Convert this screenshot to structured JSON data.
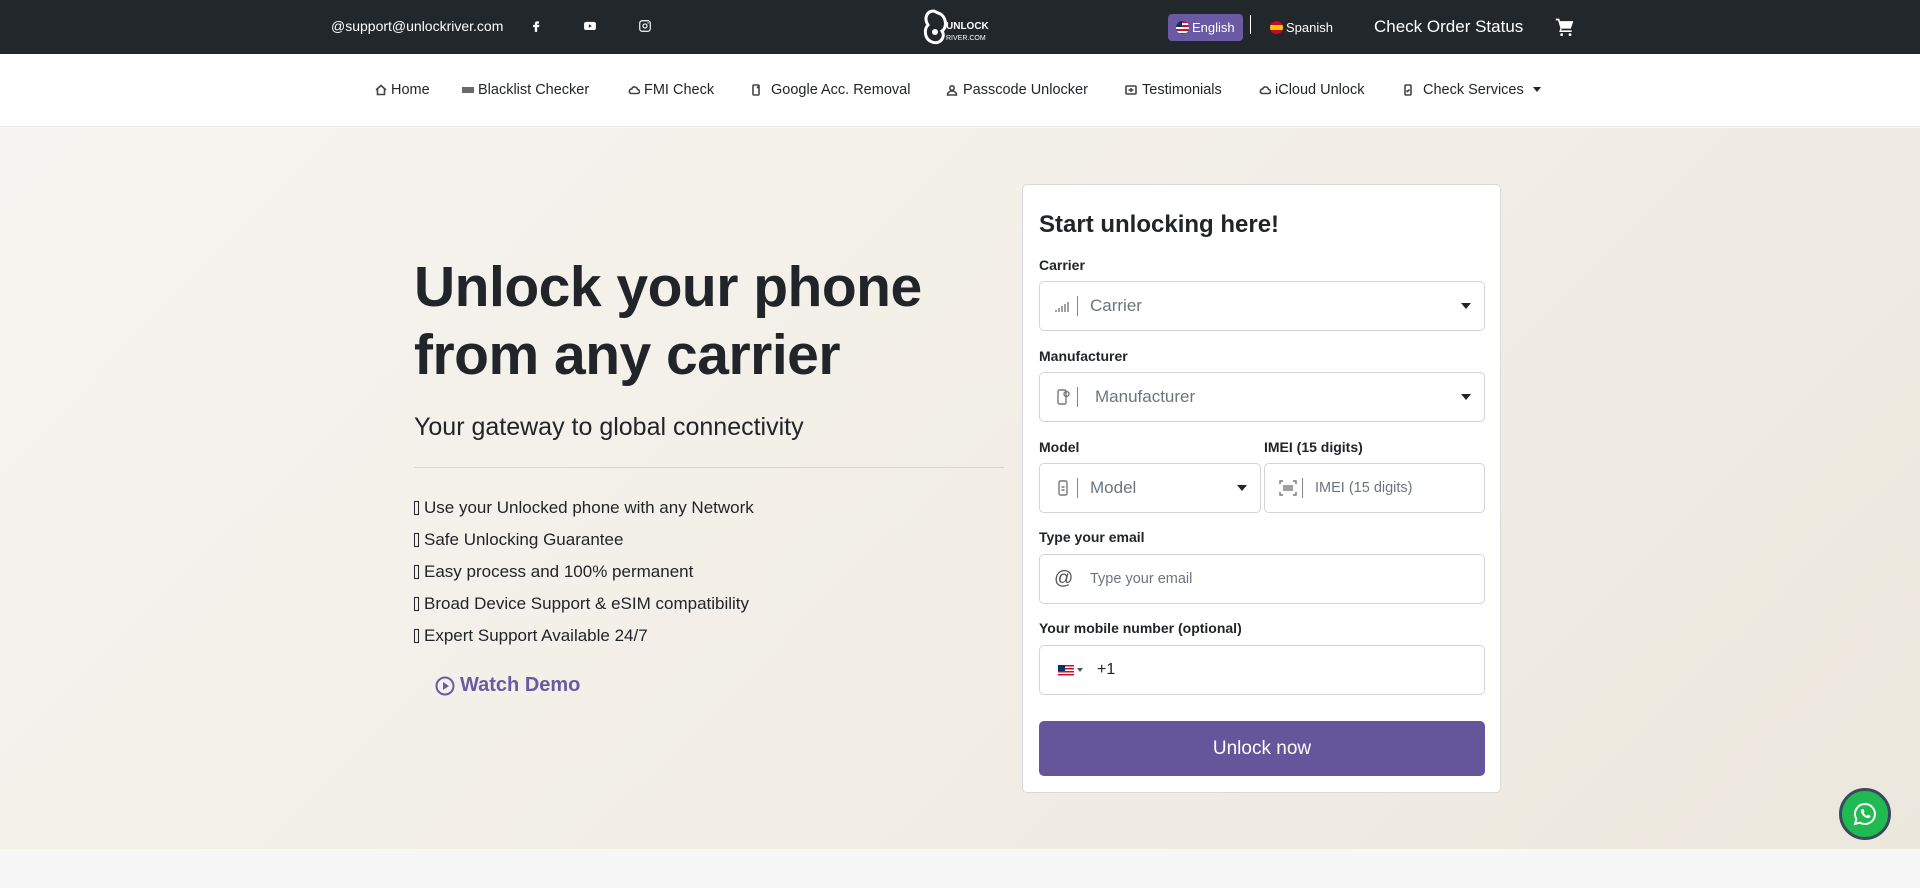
{
  "topbar": {
    "email": "@support@unlockriver.com",
    "social_icons": [
      "facebook-icon",
      "youtube-icon",
      "instagram-icon"
    ],
    "logo_text_top": "UNLOCK",
    "logo_text_bottom": "RIVER.COM",
    "lang_english": "English",
    "lang_spanish": "Spanish",
    "order_status": "Check Order Status"
  },
  "nav": {
    "items": [
      {
        "label": "Home",
        "icon": "home-icon"
      },
      {
        "label": "Blacklist Checker",
        "icon": "barcode-icon"
      },
      {
        "label": "FMI Check",
        "icon": "cloud-icon"
      },
      {
        "label": "Google Acc. Removal",
        "icon": "phone-icon"
      },
      {
        "label": "Passcode Unlocker",
        "icon": "user-lock-icon"
      },
      {
        "label": "Testimonials",
        "icon": "testimonial-icon"
      },
      {
        "label": "iCloud Unlock",
        "icon": "cloud-icon"
      },
      {
        "label": "Check Services",
        "icon": "phone-check-icon"
      }
    ]
  },
  "hero": {
    "headline": "Unlock your phone from any carrier",
    "subline": "Your gateway to global connectivity",
    "features": [
      "Use your Unlocked phone with any Network",
      "Safe Unlocking Guarantee",
      "Easy process and 100% permanent",
      "Broad Device Support & eSIM compatibility",
      "Expert Support Available 24/7"
    ],
    "watch_demo": "Watch Demo"
  },
  "form": {
    "title": "Start unlocking here!",
    "carrier_label": "Carrier",
    "carrier_placeholder": "Carrier",
    "manufacturer_label": "Manufacturer",
    "manufacturer_placeholder": "Manufacturer",
    "model_label": "Model",
    "model_placeholder": "Model",
    "imei_label": "IMEI (15 digits)",
    "imei_placeholder": "IMEI (15 digits)",
    "email_label": "Type your email",
    "email_placeholder": "Type your email",
    "mobile_label": "Your mobile number (optional)",
    "mobile_code": "+1",
    "submit": "Unlock now"
  },
  "colors": {
    "topbar_bg": "#22272b",
    "accent": "#65559b",
    "whatsapp": "#1fba52"
  }
}
